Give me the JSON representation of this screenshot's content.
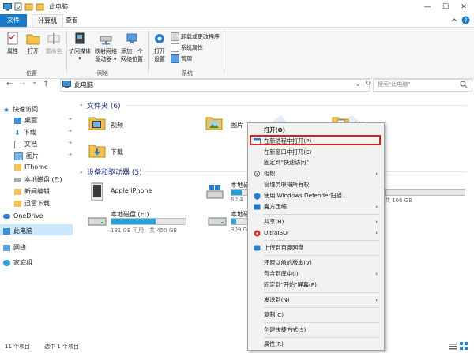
{
  "window": {
    "title": "此电脑",
    "controls": {
      "minimize": "—",
      "maximize": "☐",
      "close": "✕"
    }
  },
  "ribbon_tabs": [
    {
      "label": "文件"
    },
    {
      "label": "计算机"
    },
    {
      "label": "查看"
    }
  ],
  "ribbon": {
    "groups": {
      "location": "位置",
      "network": "网络",
      "system": "系统"
    },
    "buttons": {
      "properties": "属性",
      "open": "打开",
      "rename": "重命名",
      "media1": "访问媒体",
      "media2": "▾",
      "map1": "映射网络",
      "map2": "驱动器 ▾",
      "addloc1": "添加一个",
      "addloc2": "网络位置",
      "settings1": "打开",
      "settings2": "设置"
    },
    "small": {
      "uninstall": "卸载或更改程序",
      "sysprops": "系统属性",
      "manage": "管理"
    }
  },
  "address": {
    "back": "←",
    "forward": "→",
    "recent": "⌄",
    "up": "↑",
    "path": "此电脑",
    "search_placeholder": "搜索\"此电脑\""
  },
  "nav": {
    "items": [
      {
        "label": "快速访问"
      },
      {
        "label": "桌面"
      },
      {
        "label": "下载"
      },
      {
        "label": "文档"
      },
      {
        "label": "图片"
      },
      {
        "label": "IThome"
      },
      {
        "label": "本地磁盘 (F:)"
      },
      {
        "label": "新闻编辑"
      },
      {
        "label": "迅雷下载"
      },
      {
        "label": "OneDrive"
      },
      {
        "label": "此电脑"
      },
      {
        "label": "网络"
      },
      {
        "label": "家庭组"
      }
    ]
  },
  "content": {
    "folders_header": "文件夹 (6)",
    "folders": [
      {
        "label": "视频"
      },
      {
        "label": "图片"
      },
      {
        "label": "下载"
      }
    ],
    "partial_label": "文档",
    "drives_header": "设备和驱动器 (5)",
    "drives": [
      {
        "label": "Apple iPhone"
      },
      {
        "label": "本地磁盘 (E:)",
        "free": "181 GB 可用，共 450 GB",
        "used_fraction": 0.6
      },
      {
        "label": "本地磁",
        "free": "60.4",
        "used_fraction": 0.55
      },
      {
        "label": "本地磁",
        "free": "309 G",
        "used_fraction": 0.25
      }
    ],
    "right_partial_free": "共 106 GB",
    "right_partial_label": "B"
  },
  "status": {
    "count": "11 个项目",
    "selected": "选中 1 个项目"
  },
  "context_menu": {
    "items": [
      {
        "label": "打开(O)"
      },
      {
        "label": "在新进程中打开(P)"
      },
      {
        "label": "在新窗口中打开(E)"
      },
      {
        "label": "固定到\"快速访问\""
      },
      {
        "label": "组织"
      },
      {
        "label": "管理员取得所有权"
      },
      {
        "label": "使用 Windows Defender扫描..."
      },
      {
        "label": "魔方压缩"
      },
      {
        "label": "共享(H)"
      },
      {
        "label": "UltraISO"
      },
      {
        "label": "上传到百度网盘"
      },
      {
        "label": "还原以前的版本(V)"
      },
      {
        "label": "包含到库中(I)"
      },
      {
        "label": "固定到\"开始\"屏幕(P)"
      },
      {
        "label": "发送到(N)"
      },
      {
        "label": "复制(C)"
      },
      {
        "label": "创建快捷方式(S)"
      },
      {
        "label": "属性(R)"
      }
    ],
    "arrow": "›"
  },
  "colors": {
    "accent": "#1979ca",
    "highlight_border": "#d32121",
    "drive_fill": "#26a0da",
    "selection": "#cce8ff"
  }
}
